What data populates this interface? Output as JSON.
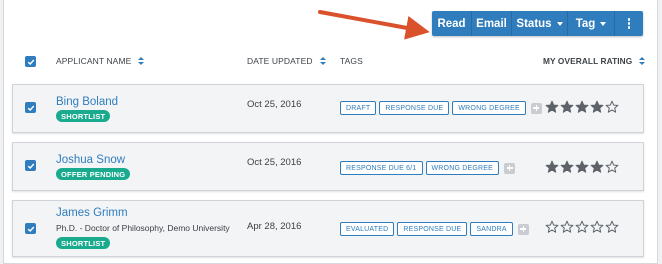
{
  "toolbar": {
    "read_label": "Read",
    "email_label": "Email",
    "status_label": "Status",
    "tag_label": "Tag"
  },
  "annotation": {
    "arrow_color": "#d9522c"
  },
  "colors": {
    "accent": "#2f7dbd",
    "badge": "#1aab8f"
  },
  "columns": {
    "applicant_name": "APPLICANT NAME",
    "date_updated": "DATE UPDATED",
    "tags": "TAGS",
    "rating": "MY OVERALL RATING"
  },
  "applicants": [
    {
      "name": "Bing Boland",
      "subtitle": "",
      "badge": "SHORTLIST",
      "date": "Oct 25, 2016",
      "tags": [
        "DRAFT",
        "RESPONSE DUE",
        "WRONG DEGREE"
      ],
      "rating": 4,
      "rating_max": 5
    },
    {
      "name": "Joshua Snow",
      "subtitle": "",
      "badge": "OFFER PENDING",
      "date": "Oct 25, 2016",
      "tags": [
        "RESPONSE DUE 6/1",
        "WRONG DEGREE"
      ],
      "rating": 4,
      "rating_max": 5
    },
    {
      "name": "James Grimm",
      "subtitle": "Ph.D. - Doctor of Philosophy, Demo University",
      "badge": "SHORTLIST",
      "date": "Apr 28, 2016",
      "tags": [
        "EVALUATED",
        "RESPONSE DUE",
        "SANDRA"
      ],
      "rating": 0,
      "rating_max": 5
    }
  ]
}
